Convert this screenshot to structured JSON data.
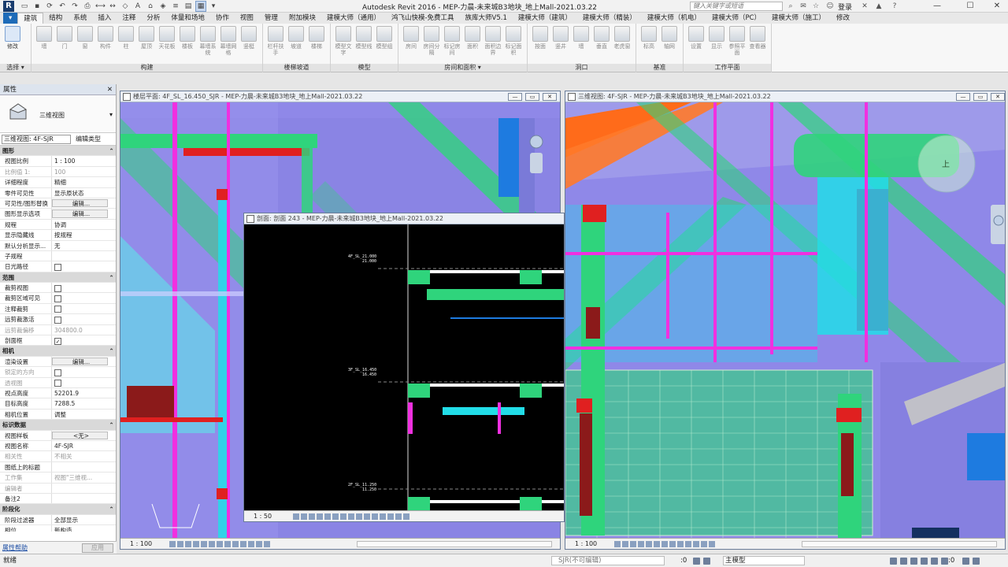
{
  "title_bar": {
    "logo": "R",
    "app_title": "Autodesk Revit 2016 -    MEP-力晨-未来城B3地块_地上Mall-2021.03.22",
    "search_placeholder": "键入关键字或短语",
    "login_label": "登录",
    "minimize": "—",
    "maximize": "☐",
    "close": "✕"
  },
  "ribbon_tabs": [
    "建筑",
    "结构",
    "系统",
    "插入",
    "注释",
    "分析",
    "体量和场地",
    "协作",
    "视图",
    "管理",
    "附加模块",
    "建模大师（通用）",
    "鸿飞山快模-免费工具",
    "族库大师V5.1",
    "建模大师（建筑）",
    "建模大师（精装）",
    "建模大师（机电）",
    "建模大师（PC）",
    "建模大师（施工）",
    "修改"
  ],
  "ribbon_active_tab": "建筑",
  "ribbon_groups": [
    {
      "title": "选择 ▾",
      "buttons": [
        "修改"
      ]
    },
    {
      "title": "构建",
      "buttons": [
        "墙",
        "门",
        "窗",
        "构件",
        "柱",
        "屋顶",
        "天花板",
        "楼板",
        "幕墙系统",
        "幕墙网格",
        "竖梃"
      ]
    },
    {
      "title": "楼梯坡道",
      "buttons": [
        "栏杆扶手",
        "坡道",
        "楼梯"
      ]
    },
    {
      "title": "模型",
      "buttons": [
        "模型文字",
        "模型线",
        "模型组"
      ]
    },
    {
      "title": "房间和面积 ▾",
      "buttons": [
        "房间",
        "房间分隔",
        "标记房间",
        "面积",
        "面积边界",
        "标记面积"
      ]
    },
    {
      "title": "洞口",
      "buttons": [
        "按面",
        "竖井",
        "墙",
        "垂直",
        "老虎窗"
      ]
    },
    {
      "title": "基准",
      "buttons": [
        "标高",
        "轴网"
      ]
    },
    {
      "title": "工作平面",
      "buttons": [
        "设置",
        "显示",
        "参照平面",
        "查看器"
      ]
    }
  ],
  "properties": {
    "header": "属性",
    "type_name": "三维视图",
    "instance_selector": "三维视图: 4F-SJR",
    "edit_type": "编辑类型",
    "rows": [
      {
        "section": "图形"
      },
      {
        "k": "视图比例",
        "v": "1 : 100"
      },
      {
        "k": "比例值 1:",
        "v": "100",
        "dim": true
      },
      {
        "k": "详细程度",
        "v": "精细"
      },
      {
        "k": "零件可见性",
        "v": "显示原状态"
      },
      {
        "k": "可见性/图形替换",
        "v": "编辑...",
        "btn": true
      },
      {
        "k": "图形显示选项",
        "v": "编辑...",
        "btn": true
      },
      {
        "k": "规程",
        "v": "协调"
      },
      {
        "k": "显示隐藏线",
        "v": "按规程"
      },
      {
        "k": "默认分析显示...",
        "v": "无"
      },
      {
        "k": "子规程",
        "v": ""
      },
      {
        "k": "日光路径",
        "v": "",
        "chk": false
      },
      {
        "section": "范围"
      },
      {
        "k": "裁剪视图",
        "v": "",
        "chk": false
      },
      {
        "k": "裁剪区域可见",
        "v": "",
        "chk": false
      },
      {
        "k": "注释裁剪",
        "v": "",
        "chk": false
      },
      {
        "k": "远剪裁激活",
        "v": "",
        "chk": false
      },
      {
        "k": "远剪裁偏移",
        "v": "304800.0",
        "dim": true
      },
      {
        "k": "剖面框",
        "v": "",
        "chk": true
      },
      {
        "section": "相机"
      },
      {
        "k": "渲染设置",
        "v": "编辑...",
        "btn": true
      },
      {
        "k": "锁定的方向",
        "v": "",
        "dim": true,
        "chk": false
      },
      {
        "k": "透视图",
        "v": "",
        "dim": true,
        "chk": false
      },
      {
        "k": "视点高度",
        "v": "52201.9"
      },
      {
        "k": "目标高度",
        "v": "7288.5"
      },
      {
        "k": "相机位置",
        "v": "调整"
      },
      {
        "section": "标识数据"
      },
      {
        "k": "视图样板",
        "v": "<无>",
        "btn": true
      },
      {
        "k": "视图名称",
        "v": "4F-SJR"
      },
      {
        "k": "相关性",
        "v": "不相关",
        "dim": true
      },
      {
        "k": "图纸上的标题",
        "v": ""
      },
      {
        "k": "工作集",
        "v": "视图\"三维视...",
        "dim": true
      },
      {
        "k": "编辑者",
        "v": "",
        "dim": true
      },
      {
        "k": "备注2",
        "v": ""
      },
      {
        "section": "阶段化"
      },
      {
        "k": "阶段过滤器",
        "v": "全部显示"
      },
      {
        "k": "相位",
        "v": "新构造"
      }
    ],
    "help": "属性帮助",
    "apply": "应用"
  },
  "views": {
    "plan": {
      "title": "楼层平面: 4F_SL_16.450_SJR - MEP-力晨-未来城B3地块_地上Mall-2021.03.22",
      "scale": "1 : 100"
    },
    "section": {
      "title": "剖面: 剖面 243 - MEP-力晨-未来城B3地块_地上Mall-2021.03.22",
      "scale": "1 : 50",
      "levels": [
        {
          "name": "4F_SL_21.000",
          "elev": "21.000"
        },
        {
          "name": "3F_SL_16.450",
          "elev": "16.450"
        },
        {
          "name": "2F_SL_11.250",
          "elev": "11.250"
        }
      ]
    },
    "three_d": {
      "title": "三维视图: 4F-SJR - MEP-力晨-未来城B3地块_地上Mall-2021.03.22",
      "scale": "1 : 100",
      "viewcube_label": "上"
    }
  },
  "statusbar": {
    "ready": "就绪",
    "workset": "SJR(不可编辑)",
    "zero": ":0",
    "model": "主模型",
    "zero2": ":0"
  },
  "colors": {
    "pipe_green": "#2fd47c",
    "cyan": "#22dde8",
    "magenta": "#f030e0",
    "purple_bg": "#8f88e8",
    "orange": "#ff6b1a",
    "red": "#e02020",
    "dark_red": "#8b1a1a"
  }
}
